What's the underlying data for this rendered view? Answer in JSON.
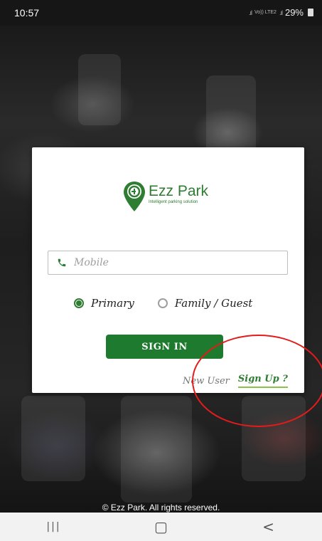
{
  "status_bar": {
    "time": "10:57",
    "network": "Vo)) LTE2",
    "battery": "29%"
  },
  "card": {
    "brand_name": "Ezz Park",
    "tagline": "Intelligent parking solution",
    "mobile_placeholder": "Mobile",
    "radio_options": [
      {
        "label": "Primary",
        "selected": true
      },
      {
        "label": "Family / Guest",
        "selected": false
      }
    ],
    "signin_label": "SIGN IN",
    "new_user_label": "New User",
    "signup_label": "Sign Up ?"
  },
  "footer": {
    "copyright": "© Ezz Park. All rights reserved."
  },
  "nav_bar": {
    "recents": "|||",
    "home": "▢",
    "back": "<"
  },
  "colors": {
    "brand_green": "#2e7d32",
    "button_green": "#1e7a2e",
    "annotation_red": "#e41b1b"
  }
}
